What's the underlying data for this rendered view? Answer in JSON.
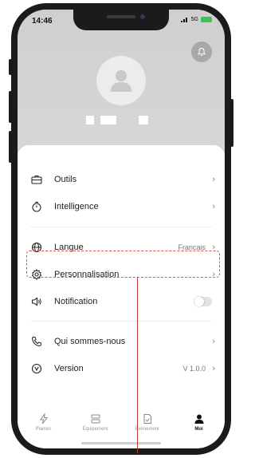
{
  "status": {
    "time": "14:46",
    "network": "5G",
    "battery": ""
  },
  "profile": {
    "name_placeholder": ""
  },
  "menu": {
    "outils": "Outils",
    "intelligence": "Intelligence",
    "langue": "Langue",
    "langue_value": "Francais",
    "personnalisation": "Personnalisation",
    "notification": "Notification",
    "qui_sommes_nous": "Qui sommes-nous",
    "version": "Version",
    "version_value": "V 1.0.0"
  },
  "tabs": [
    {
      "label": "Plantes",
      "icon": "bolt-icon"
    },
    {
      "label": "Équipement",
      "icon": "device-icon"
    },
    {
      "label": "Événement",
      "icon": "document-icon"
    },
    {
      "label": "Moi",
      "icon": "person-icon"
    }
  ],
  "colors": {
    "highlight": "#e05252",
    "accent": "#111111"
  }
}
